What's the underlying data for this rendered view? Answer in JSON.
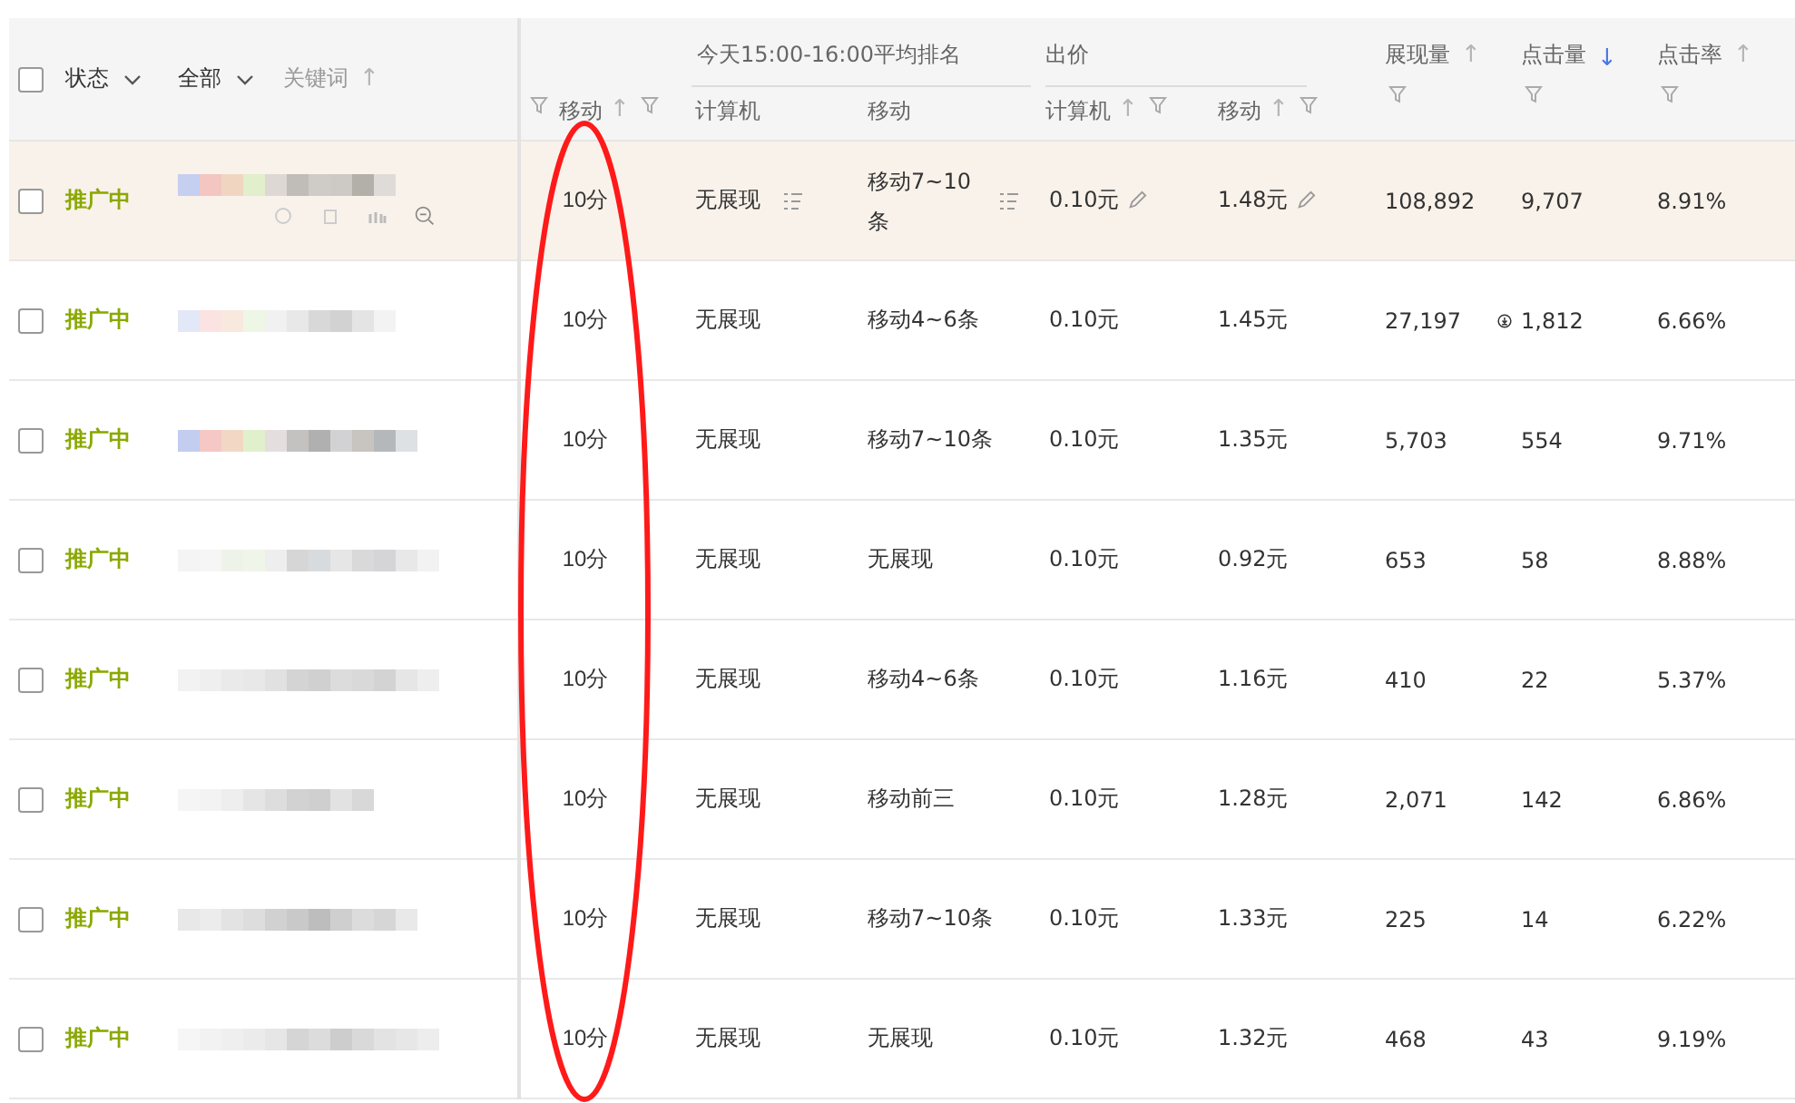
{
  "header": {
    "select_all_checked": false,
    "status": "状态",
    "scope": "全部",
    "keyword": {
      "label": "关键词",
      "arrow": "↑",
      "active": false
    },
    "score": {
      "label": "移动",
      "arrow": "↑",
      "active": false
    },
    "rank_group": "今天15:00-16:00平均排名",
    "rank_pc": "计算机",
    "rank_mobile": "移动",
    "bid_group": "出价",
    "bid_pc": {
      "label": "计算机",
      "arrow": "↑",
      "active": false
    },
    "bid_mobile": {
      "label": "移动",
      "arrow": "↑",
      "active": false
    },
    "impressions": {
      "label": "展现量",
      "arrow": "↑",
      "active": false
    },
    "clicks": {
      "label": "点击量",
      "arrow": "↓",
      "active": true
    },
    "ctr": {
      "label": "点击率",
      "arrow": "↑",
      "active": false
    }
  },
  "rows": [
    {
      "checked": false,
      "highlighted": true,
      "status": "推广中",
      "score": "10分",
      "rank_pc": "无展现",
      "rank_mobile": "移动7~10条",
      "bid_pc": "0.10元",
      "bid_mobile": "1.48元",
      "impressions": "108,892",
      "info_icon": false,
      "clicks": "9,707",
      "ctr": "8.91%"
    },
    {
      "checked": false,
      "highlighted": false,
      "status": "推广中",
      "score": "10分",
      "rank_pc": "无展现",
      "rank_mobile": "移动4~6条",
      "bid_pc": "0.10元",
      "bid_mobile": "1.45元",
      "impressions": "27,197",
      "info_icon": true,
      "clicks": "1,812",
      "ctr": "6.66%"
    },
    {
      "checked": false,
      "highlighted": false,
      "status": "推广中",
      "score": "10分",
      "rank_pc": "无展现",
      "rank_mobile": "移动7~10条",
      "bid_pc": "0.10元",
      "bid_mobile": "1.35元",
      "impressions": "5,703",
      "info_icon": false,
      "clicks": "554",
      "ctr": "9.71%"
    },
    {
      "checked": false,
      "highlighted": false,
      "status": "推广中",
      "score": "10分",
      "rank_pc": "无展现",
      "rank_mobile": "无展现",
      "bid_pc": "0.10元",
      "bid_mobile": "0.92元",
      "impressions": "653",
      "info_icon": false,
      "clicks": "58",
      "ctr": "8.88%"
    },
    {
      "checked": false,
      "highlighted": false,
      "status": "推广中",
      "score": "10分",
      "rank_pc": "无展现",
      "rank_mobile": "移动4~6条",
      "bid_pc": "0.10元",
      "bid_mobile": "1.16元",
      "impressions": "410",
      "info_icon": false,
      "clicks": "22",
      "ctr": "5.37%"
    },
    {
      "checked": false,
      "highlighted": false,
      "status": "推广中",
      "score": "10分",
      "rank_pc": "无展现",
      "rank_mobile": "移动前三",
      "bid_pc": "0.10元",
      "bid_mobile": "1.28元",
      "impressions": "2,071",
      "info_icon": false,
      "clicks": "142",
      "ctr": "6.86%"
    },
    {
      "checked": false,
      "highlighted": false,
      "status": "推广中",
      "score": "10分",
      "rank_pc": "无展现",
      "rank_mobile": "移动7~10条",
      "bid_pc": "0.10元",
      "bid_mobile": "1.33元",
      "impressions": "225",
      "info_icon": false,
      "clicks": "14",
      "ctr": "6.22%"
    },
    {
      "checked": false,
      "highlighted": false,
      "status": "推广中",
      "score": "10分",
      "rank_pc": "无展现",
      "rank_mobile": "无展现",
      "bid_pc": "0.10元",
      "bid_mobile": "1.32元",
      "impressions": "468",
      "info_icon": false,
      "clicks": "43",
      "ctr": "9.19%"
    }
  ],
  "annotation": {
    "kind": "ellipse"
  }
}
